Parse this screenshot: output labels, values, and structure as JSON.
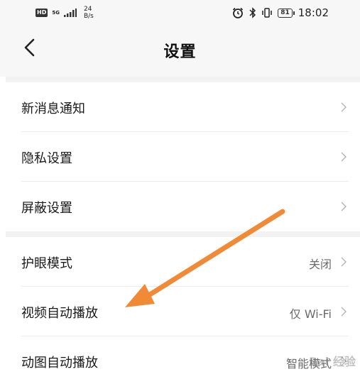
{
  "status_bar": {
    "network_badge": "HD",
    "network_type": "5G",
    "speed_value": "24",
    "speed_unit": "B/s",
    "time": "18:02",
    "battery": "81",
    "icons": [
      "alarm-icon",
      "bluetooth-icon",
      "vibrate-icon",
      "battery-icon"
    ]
  },
  "header": {
    "title": "设置",
    "back_icon": "chevron-left-icon"
  },
  "sections": [
    {
      "items": [
        {
          "label": "新消息通知",
          "value": ""
        },
        {
          "label": "隐私设置",
          "value": ""
        },
        {
          "label": "屏蔽设置",
          "value": ""
        }
      ]
    },
    {
      "items": [
        {
          "label": "护眼模式",
          "value": "关闭"
        },
        {
          "label": "视频自动播放",
          "value": "仅 Wi-Fi"
        },
        {
          "label": "动图自动播放",
          "value": "智能模式"
        }
      ]
    }
  ],
  "annotation": {
    "arrow_color": "#f08a36",
    "arrow_icon": "orange-arrow-annotation"
  },
  "watermark_text": "Bai 经验"
}
